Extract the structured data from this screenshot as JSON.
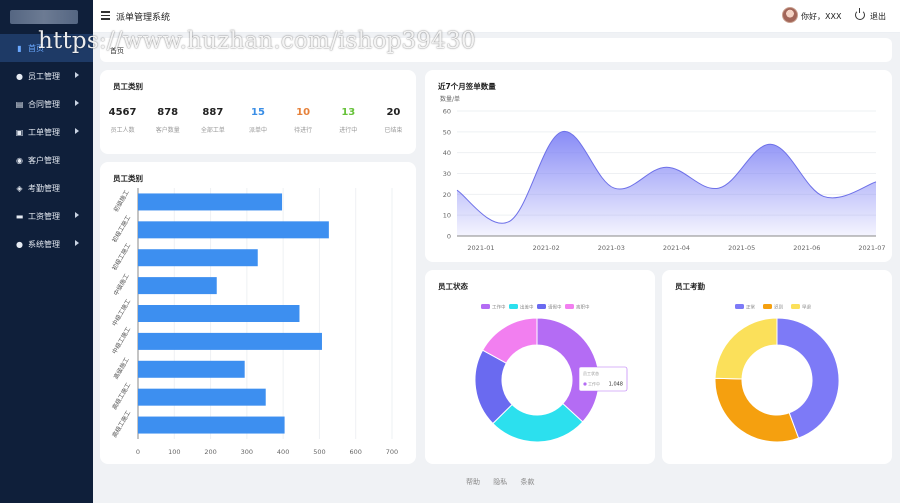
{
  "app": {
    "title": "派单管理系统"
  },
  "header": {
    "greeting": "你好，XXX",
    "logout_label": "退出"
  },
  "watermark": "https://www.huzhan.com/ishop39430",
  "sidebar": {
    "items": [
      {
        "label": "首页",
        "icon": "chart-icon",
        "active": true,
        "has_arrow": false
      },
      {
        "label": "员工管理",
        "icon": "user-icon",
        "active": false,
        "has_arrow": true
      },
      {
        "label": "合同管理",
        "icon": "contract-icon",
        "active": false,
        "has_arrow": true
      },
      {
        "label": "工单管理",
        "icon": "clipboard-icon",
        "active": false,
        "has_arrow": true
      },
      {
        "label": "客户管理",
        "icon": "customers-icon",
        "active": false,
        "has_arrow": false
      },
      {
        "label": "考勤管理",
        "icon": "location-icon",
        "active": false,
        "has_arrow": false
      },
      {
        "label": "工资管理",
        "icon": "wallet-icon",
        "active": false,
        "has_arrow": true
      },
      {
        "label": "系统管理",
        "icon": "settings-user-icon",
        "active": false,
        "has_arrow": true
      }
    ]
  },
  "notice": {
    "text": "首页"
  },
  "stats_card": {
    "title": "员工类别",
    "stats": [
      {
        "value": "4567",
        "label": "员工人数",
        "color": "#222222"
      },
      {
        "value": "878",
        "label": "客户数量",
        "color": "#222222"
      },
      {
        "value": "887",
        "label": "全部工单",
        "color": "#222222"
      },
      {
        "value": "15",
        "label": "派单中",
        "color": "#3a8ee6"
      },
      {
        "value": "10",
        "label": "待进行",
        "color": "#e6813a"
      },
      {
        "value": "13",
        "label": "进行中",
        "color": "#67c23a"
      },
      {
        "value": "20",
        "label": "已结束",
        "color": "#222222"
      }
    ]
  },
  "bar_card": {
    "title": "员工类别"
  },
  "line_card": {
    "title": "近7个月签单数量"
  },
  "status_card": {
    "title": "员工状态"
  },
  "attendance_card": {
    "title": "员工考勤"
  },
  "footer": {
    "links": [
      "帮助",
      "隐私",
      "条款"
    ]
  },
  "chart_data": [
    {
      "type": "bar",
      "orientation": "horizontal",
      "categories": [
        "初级施工",
        "初级工施工",
        "初级工施工",
        "中级施工",
        "中级工施工",
        "中级工施工",
        "高级施工",
        "高级工施工",
        "高级工施工"
      ],
      "values": [
        397,
        526,
        330,
        217,
        445,
        507,
        294,
        352,
        404
      ],
      "xlim": [
        0,
        700
      ],
      "xticks": [
        0,
        100,
        200,
        300,
        400,
        500,
        600,
        700
      ],
      "color": "#3d8ff0",
      "grid": true
    },
    {
      "type": "area",
      "categories": [
        "2021-01",
        "2021-02",
        "2021-03",
        "2021-04",
        "2021-05",
        "2021-06",
        "2021-07"
      ],
      "values": [
        22,
        7,
        50,
        23,
        33,
        23,
        44,
        19,
        26
      ],
      "x_index": [
        0,
        0.5,
        1,
        1.5,
        2,
        2.5,
        3,
        3.5,
        4
      ],
      "y_axis_name": "数量/单",
      "ylim": [
        0,
        60
      ],
      "yticks": [
        0,
        10,
        20,
        30,
        40,
        50,
        60
      ],
      "color": "#7b7ff5",
      "grid": true
    },
    {
      "type": "pie",
      "donut": true,
      "legend_position": "top",
      "series": [
        {
          "name": "工作中",
          "value": 1048,
          "color": "#b46cf4"
        },
        {
          "name": "出差中",
          "value": 735,
          "color": "#2ce0ee"
        },
        {
          "name": "请假中",
          "value": 580,
          "color": "#6a6af0"
        },
        {
          "name": "离职中",
          "value": 484,
          "color": "#f27ff0"
        }
      ],
      "tooltip": {
        "title": "员工状态",
        "label": "工作中",
        "value": "1,048"
      }
    },
    {
      "type": "pie",
      "donut": true,
      "legend_position": "top",
      "series": [
        {
          "name": "正常",
          "value": 1048,
          "color": "#7d7af7"
        },
        {
          "name": "迟到",
          "value": 735,
          "color": "#f5a00f"
        },
        {
          "name": "早退",
          "value": 580,
          "color": "#fbe05a"
        }
      ]
    }
  ]
}
